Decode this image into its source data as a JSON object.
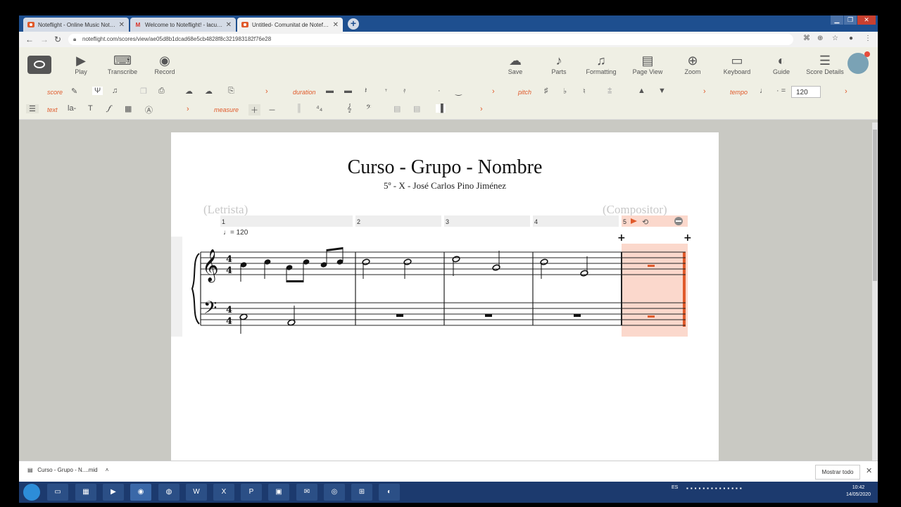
{
  "browser": {
    "tabs": [
      {
        "title": "Noteflight - Online Music Notatio",
        "favicon": "noteflight-icon",
        "active": false
      },
      {
        "title": "Welcome to Noteflight! - lacuem",
        "favicon": "gmail-icon",
        "active": false
      },
      {
        "title": "Untitled- Comunitat de Noteflight",
        "favicon": "noteflight-icon",
        "active": true
      }
    ],
    "url": "noteflight.com/scores/view/ae05d8b1dcad68e5cb4828f8c321983182f76e28"
  },
  "toolbar": {
    "left": [
      {
        "label": "Play",
        "icon": "play-icon",
        "glyph": "▶"
      },
      {
        "label": "Transcribe",
        "icon": "keyboard-icon",
        "glyph": "⌨"
      },
      {
        "label": "Record",
        "icon": "record-icon",
        "glyph": "◉"
      }
    ],
    "right": [
      {
        "label": "Save",
        "icon": "cloud-upload-icon",
        "glyph": "☁"
      },
      {
        "label": "Parts",
        "icon": "guitar-icon",
        "glyph": "♪"
      },
      {
        "label": "Formatting",
        "icon": "formatting-icon",
        "glyph": "♫"
      },
      {
        "label": "Page View",
        "icon": "page-icon",
        "glyph": "▤"
      },
      {
        "label": "Zoom",
        "icon": "zoom-icon",
        "glyph": "⊕"
      },
      {
        "label": "Keyboard",
        "icon": "keyboard-icon",
        "glyph": "▭"
      },
      {
        "label": "Guide",
        "icon": "guide-icon",
        "glyph": "◐"
      },
      {
        "label": "Score Details",
        "icon": "details-icon",
        "glyph": "☰"
      }
    ]
  },
  "palette": {
    "row1": {
      "score": "score",
      "duration": "duration",
      "pitch": "pitch",
      "tempo": "tempo",
      "tempo_value": "120"
    },
    "row2": {
      "text": "text",
      "measure": "measure"
    }
  },
  "score": {
    "title": "Curso - Grupo - Nombre",
    "subtitle": "5º - X - José Carlos Pino Jiménez",
    "lyricist": "(Letrista)",
    "composer": "(Compositor)",
    "tempo_mark": "= 120",
    "measure_numbers": [
      "1",
      "2",
      "3",
      "4",
      "5"
    ],
    "time_signature": [
      "4",
      "4"
    ]
  },
  "downloads": {
    "item": "Curso - Grupo - N....mid",
    "show_all": "Mostrar todo"
  },
  "taskbar": {
    "lang": "ES",
    "time": "10:42",
    "date": "14/05/2020"
  },
  "colors": {
    "accent": "#e05a2b",
    "selection": "#fbd8cc",
    "tabbar": "#1e4f8f"
  }
}
